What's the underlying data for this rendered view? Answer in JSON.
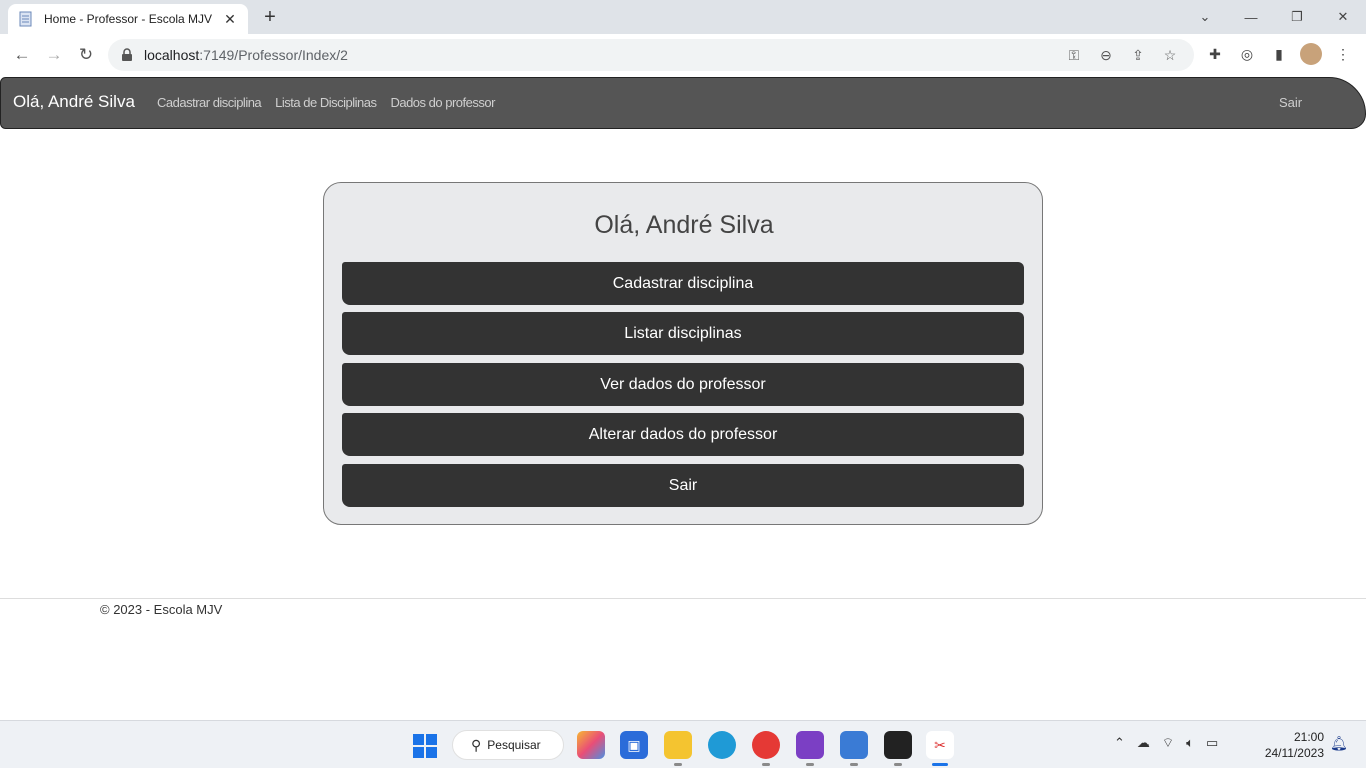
{
  "browser": {
    "tab_title": "Home - Professor - Escola MJV",
    "new_tab": "+",
    "url_host": "localhost",
    "url_path": ":7149/Professor/Index/2"
  },
  "app": {
    "brand": "Olá, André Silva",
    "nav": [
      "Cadastrar disciplina",
      "Lista de Disciplinas",
      "Dados do professor"
    ],
    "logout": "Sair"
  },
  "card": {
    "title": "Olá, André Silva",
    "buttons": [
      "Cadastrar disciplina",
      "Listar disciplinas",
      "Ver dados do professor",
      "Alterar dados do professor",
      "Sair"
    ]
  },
  "footer": {
    "text": "© 2023 - Escola MJV"
  },
  "taskbar": {
    "search_label": "Pesquisar",
    "time": "21:00",
    "date": "24/11/2023"
  },
  "colors": {
    "navbar": "#555555",
    "button": "#333333",
    "card_bg": "#e9eaec"
  }
}
